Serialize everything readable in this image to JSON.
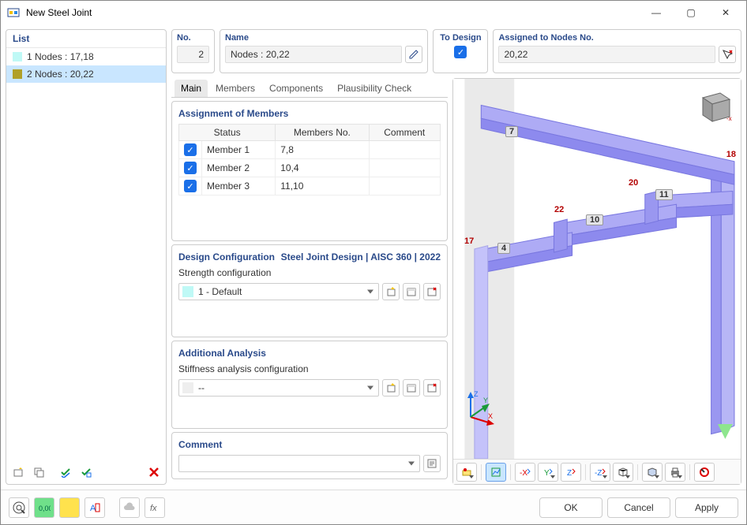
{
  "window": {
    "title": "New Steel Joint"
  },
  "win_controls": {
    "min": "—",
    "max": "▢",
    "close": "✕"
  },
  "left": {
    "header": "List",
    "items": [
      {
        "color": "#bff9f6",
        "label": "1 Nodes : 17,18"
      },
      {
        "color": "#b0a028",
        "label": "2 Nodes : 20,22"
      }
    ]
  },
  "top": {
    "no_label": "No.",
    "no_value": "2",
    "name_label": "Name",
    "name_value": "Nodes : 20,22",
    "todesign_label": "To Design",
    "assigned_label": "Assigned to Nodes No.",
    "assigned_value": "20,22"
  },
  "tabs": {
    "main": "Main",
    "members": "Members",
    "components": "Components",
    "plaus": "Plausibility Check"
  },
  "assign": {
    "header": "Assignment of Members",
    "cols": {
      "status": "Status",
      "members": "Members No.",
      "comment": "Comment"
    },
    "rows": [
      {
        "name": "Member 1",
        "members": "7,8",
        "comment": ""
      },
      {
        "name": "Member 2",
        "members": "10,4",
        "comment": ""
      },
      {
        "name": "Member 3",
        "members": "11,10",
        "comment": ""
      }
    ]
  },
  "design": {
    "header": "Design Configuration",
    "code": "Steel Joint Design | AISC 360 | 2022",
    "label": "Strength configuration",
    "value": "1 - Default"
  },
  "additional": {
    "header": "Additional Analysis",
    "label": "Stiffness analysis configuration",
    "value": "--"
  },
  "comment": {
    "header": "Comment",
    "value": ""
  },
  "viewport": {
    "beams": [
      "7",
      "20",
      "11",
      "22",
      "10",
      "17",
      "4",
      "18"
    ],
    "axes": [
      "X",
      "Y",
      "Z"
    ]
  },
  "footer": {
    "ok": "OK",
    "cancel": "Cancel",
    "apply": "Apply"
  }
}
